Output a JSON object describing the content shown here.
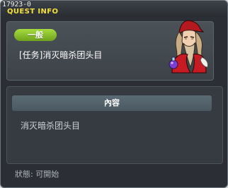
{
  "window": {
    "quest_id": "17923-0",
    "title": "QUEST INFO"
  },
  "quest": {
    "category_badge": "一般",
    "name": "[任务]消灭暗杀团头目"
  },
  "content": {
    "header": "內容",
    "text": "消灭暗杀团头目"
  },
  "status": {
    "label": "狀態",
    "value": "可開始",
    "text": "狀態: 可開始"
  },
  "npc": {
    "icon": "npc-portrait"
  }
}
